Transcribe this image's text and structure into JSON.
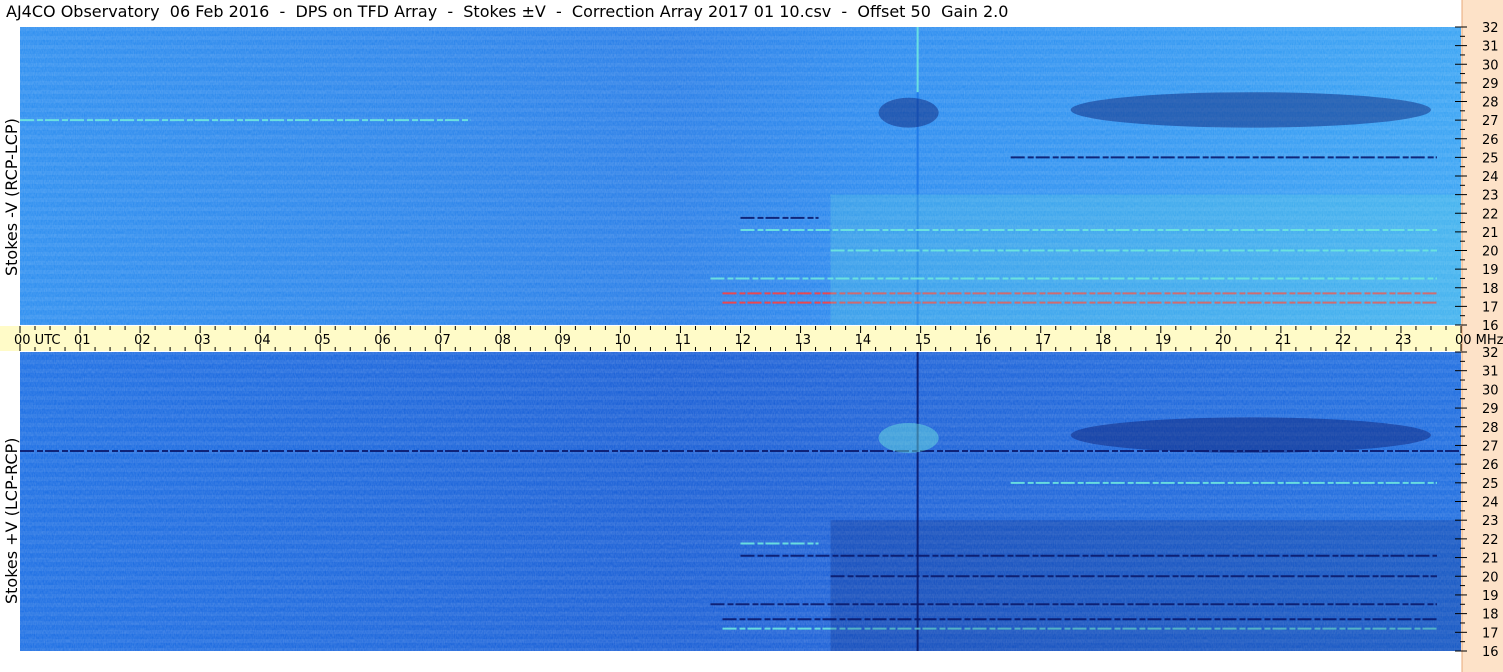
{
  "header": {
    "title": "AJ4CO Observatory  06 Feb 2016  -  DPS on TFD Array  -  Stokes ±V  -  Correction Array 2017 01 10.csv  -  Offset 50  Gain 2.0"
  },
  "colors": {
    "background": "#ffffff",
    "time_axis_band": "#fffbc8",
    "freq_axis_band": "#fde2c8",
    "spectrogram_low": "#0a1a6e",
    "spectrogram_mid": "#1f78e8",
    "spectrogram_high": "#6fe8e0",
    "spectrogram_peak": "#ff4040"
  },
  "chart_data": [
    {
      "type": "heatmap",
      "panel": "top",
      "ylabel": "Stokes -V (RCP-LCP)",
      "x_ticks": [
        "00 UTC",
        "01",
        "02",
        "03",
        "04",
        "05",
        "06",
        "07",
        "08",
        "09",
        "10",
        "11",
        "12",
        "13",
        "14",
        "15",
        "16",
        "17",
        "18",
        "19",
        "20",
        "21",
        "22",
        "23",
        "00 MHz"
      ],
      "xlim": [
        0,
        24
      ],
      "x_unit": "UTC hours",
      "y_ticks": [
        "16",
        "17",
        "18",
        "19",
        "20",
        "21",
        "22",
        "23",
        "24",
        "25",
        "26",
        "27",
        "28",
        "29",
        "30",
        "31",
        "32"
      ],
      "ylim": [
        16,
        32
      ],
      "y_unit": "MHz",
      "features": [
        {
          "kind": "broadband_line",
          "x": 14.95,
          "y": [
            28.5,
            32
          ],
          "level": "high"
        },
        {
          "kind": "broadband_line",
          "x": 14.95,
          "y": [
            16,
            28.5
          ],
          "level": "mid"
        },
        {
          "kind": "narrowband",
          "x": [
            0.0,
            7.5
          ],
          "y": 27.0,
          "level": "high"
        },
        {
          "kind": "narrowband",
          "x": [
            16.5,
            23.6
          ],
          "y": 25.0,
          "level": "low"
        },
        {
          "kind": "narrowband",
          "x": [
            12.0,
            13.3
          ],
          "y": 21.75,
          "level": "low"
        },
        {
          "kind": "narrowband",
          "x": [
            12.0,
            23.6
          ],
          "y": 21.1,
          "level": "high"
        },
        {
          "kind": "narrowband",
          "x": [
            13.5,
            23.6
          ],
          "y": 20.0,
          "level": "high"
        },
        {
          "kind": "narrowband",
          "x": [
            11.5,
            23.6
          ],
          "y": 18.5,
          "level": "high"
        },
        {
          "kind": "narrowband",
          "x": [
            11.7,
            23.6
          ],
          "y": 17.7,
          "level": "peak"
        },
        {
          "kind": "narrowband",
          "x": [
            11.7,
            23.6
          ],
          "y": 17.2,
          "level": "peak"
        },
        {
          "kind": "patch",
          "x": [
            14.3,
            15.3
          ],
          "y": [
            26.6,
            28.2
          ],
          "level": "low"
        },
        {
          "kind": "patch",
          "x": [
            17.5,
            23.5
          ],
          "y": [
            26.6,
            28.5
          ],
          "level": "low"
        },
        {
          "kind": "region",
          "x": [
            13.5,
            24.0
          ],
          "y": [
            16,
            23
          ],
          "level": "high"
        }
      ]
    },
    {
      "type": "heatmap",
      "panel": "bottom",
      "ylabel": "Stokes +V (LCP-RCP)",
      "x_ticks": [
        "00 UTC",
        "01",
        "02",
        "03",
        "04",
        "05",
        "06",
        "07",
        "08",
        "09",
        "10",
        "11",
        "12",
        "13",
        "14",
        "15",
        "16",
        "17",
        "18",
        "19",
        "20",
        "21",
        "22",
        "23",
        "00 MHz"
      ],
      "xlim": [
        0,
        24
      ],
      "x_unit": "UTC hours",
      "y_ticks": [
        "16",
        "17",
        "18",
        "19",
        "20",
        "21",
        "22",
        "23",
        "24",
        "25",
        "26",
        "27",
        "28",
        "29",
        "30",
        "31",
        "32"
      ],
      "ylim": [
        16,
        32
      ],
      "y_unit": "MHz",
      "features": [
        {
          "kind": "broadband_line",
          "x": 14.95,
          "y": [
            28.5,
            32
          ],
          "level": "low"
        },
        {
          "kind": "broadband_line",
          "x": 14.95,
          "y": [
            16,
            28.5
          ],
          "level": "low"
        },
        {
          "kind": "narrowband",
          "x": [
            0.0,
            24.0
          ],
          "y": 26.7,
          "level": "low"
        },
        {
          "kind": "narrowband",
          "x": [
            16.5,
            23.6
          ],
          "y": 25.0,
          "level": "high"
        },
        {
          "kind": "narrowband",
          "x": [
            12.0,
            13.3
          ],
          "y": 21.75,
          "level": "high"
        },
        {
          "kind": "narrowband",
          "x": [
            12.0,
            23.6
          ],
          "y": 21.1,
          "level": "low"
        },
        {
          "kind": "narrowband",
          "x": [
            13.5,
            23.6
          ],
          "y": 20.0,
          "level": "low"
        },
        {
          "kind": "narrowband",
          "x": [
            11.5,
            23.6
          ],
          "y": 18.5,
          "level": "low"
        },
        {
          "kind": "narrowband",
          "x": [
            11.7,
            23.6
          ],
          "y": 17.7,
          "level": "low"
        },
        {
          "kind": "narrowband",
          "x": [
            11.7,
            23.6
          ],
          "y": 17.2,
          "level": "high"
        },
        {
          "kind": "patch",
          "x": [
            14.3,
            15.3
          ],
          "y": [
            26.6,
            28.2
          ],
          "level": "high"
        },
        {
          "kind": "patch",
          "x": [
            17.5,
            23.5
          ],
          "y": [
            26.6,
            28.5
          ],
          "level": "low"
        },
        {
          "kind": "region",
          "x": [
            13.5,
            24.0
          ],
          "y": [
            16,
            23
          ],
          "level": "low"
        }
      ]
    }
  ]
}
